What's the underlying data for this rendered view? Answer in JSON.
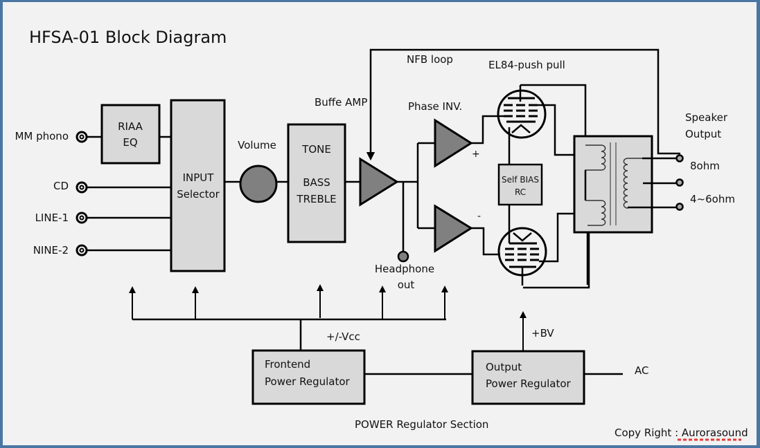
{
  "title": "HFSA-01 Block Diagram",
  "colors": {
    "frame": "#4a76a3",
    "background": "#f2f2f2",
    "block_fill": "#d9d9d9",
    "amp_fill": "#808080",
    "line": "#000000",
    "spellcheck": "#e53935"
  },
  "inputs": [
    {
      "label": "MM phono"
    },
    {
      "label": "CD"
    },
    {
      "label": "LINE-1"
    },
    {
      "label": "NINE-2"
    }
  ],
  "blocks": {
    "riaa": {
      "line1": "RIAA",
      "line2": "EQ"
    },
    "input_selector": {
      "line1": "INPUT",
      "line2": "Selector"
    },
    "volume": {
      "label": "Volume"
    },
    "tone": {
      "line1": "TONE",
      "line2": "BASS",
      "line3": "TREBLE"
    },
    "buffer_amp": {
      "label": "Buffe AMP"
    },
    "headphone": {
      "line1": "Headphone",
      "line2": "out"
    },
    "phase_inv": {
      "label": "Phase INV.",
      "plus": "+",
      "minus": "-"
    },
    "nfb": {
      "label": "NFB loop"
    },
    "output_tubes": {
      "label": "EL84-push pull"
    },
    "self_bias": {
      "line1": "Self BIAS",
      "line2": "RC"
    },
    "speaker": {
      "line1": "Speaker",
      "line2": "Output",
      "tap_8": "8ohm",
      "tap_4_6": "4~6ohm"
    }
  },
  "power": {
    "vcc_label": "+/-Vcc",
    "bv_label": "+BV",
    "frontend": {
      "line1": "Frontend",
      "line2": "Power Regulator"
    },
    "output": {
      "line1": "Output",
      "line2": "Power Regulator"
    },
    "ac_label": "AC",
    "section_label": "POWER Regulator Section"
  },
  "copyright": {
    "prefix": "Copy Right : ",
    "name": "Aurorasound"
  }
}
